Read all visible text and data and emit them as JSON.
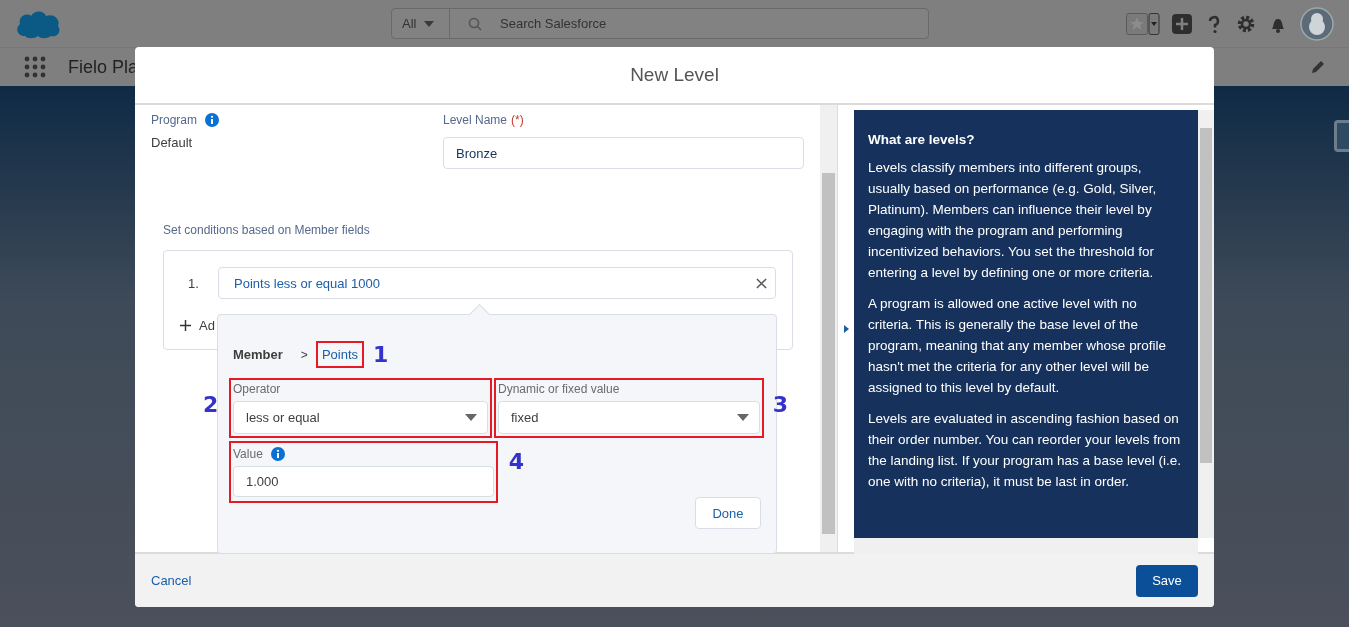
{
  "header": {
    "search_scope": "All",
    "search": {
      "placeholder": "Search Salesforce"
    }
  },
  "app_nav": {
    "app_name": "Fielo Pla"
  },
  "modal": {
    "title": "New Level",
    "program": {
      "label": "Program",
      "value": "Default"
    },
    "level_name": {
      "label": "Level Name",
      "required_mark": "(*)",
      "value": "Bronze"
    },
    "conditions": {
      "heading": "Set conditions based on Member fields",
      "items": [
        {
          "number": "1.",
          "summary": "Points less or equal 1000"
        }
      ],
      "add_label": "Ad"
    },
    "editor": {
      "object": "Member",
      "separator": ">",
      "field": "Points",
      "field_callout": "1",
      "operator": {
        "label": "Operator",
        "value": "less or equal",
        "callout": "2"
      },
      "value_type": {
        "label": "Dynamic or fixed value",
        "value": "fixed",
        "callout": "3"
      },
      "value": {
        "label": "Value",
        "value": "1.000",
        "callout": "4"
      },
      "done": "Done"
    },
    "help": {
      "title": "What are levels?",
      "paragraphs": [
        "Levels classify members into different groups, usually based on performance (e.g. Gold, Silver, Platinum). Members can influence their level by engaging with the program and performing incentivized behaviors. You set the threshold for entering a level by defining one or more criteria.",
        "A program is allowed one active level with no criteria. This is generally the base level of the program, meaning that any member whose profile hasn't met the criteria for any other level will be assigned to this level by default.",
        "Levels are evaluated in ascending fashion based on their order number. You can reorder your levels from the landing list. If your program has a base level (i.e. one with no criteria), it must be last in order."
      ]
    },
    "footer": {
      "cancel": "Cancel",
      "save": "Save"
    }
  }
}
